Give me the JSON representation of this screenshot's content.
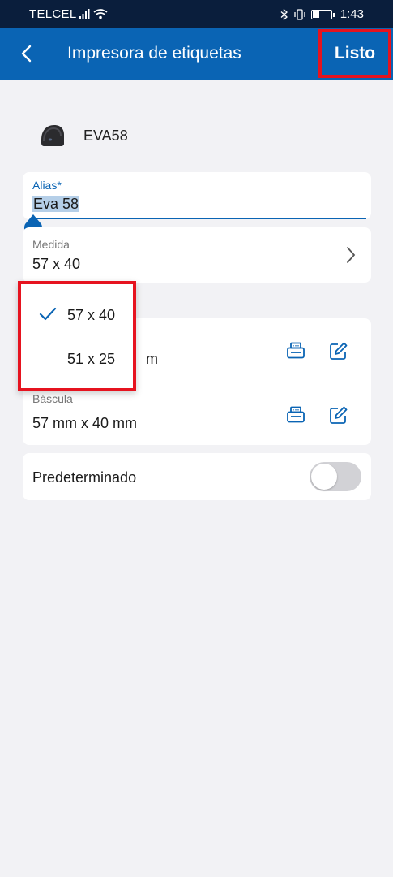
{
  "status_bar": {
    "carrier": "TELCEL",
    "time": "1:43"
  },
  "header": {
    "title": "Impresora de etiquetas",
    "done_label": "Listo"
  },
  "device": {
    "name": "EVA58",
    "icon": "label-printer-icon"
  },
  "alias": {
    "label": "Alias*",
    "value": "Eva 58"
  },
  "medida": {
    "label": "Medida",
    "value": "57 x 40"
  },
  "formats": {
    "rows": [
      {
        "label": "",
        "value": "m"
      },
      {
        "label": "Báscula",
        "value": "57 mm x 40 mm"
      }
    ]
  },
  "default_setting": {
    "label": "Predeterminado",
    "enabled": false
  },
  "size_dropdown": {
    "options": [
      {
        "label": "57 x 40",
        "selected": true
      },
      {
        "label": "51 x 25",
        "selected": false
      }
    ]
  },
  "colors": {
    "status_bar": "#0a1e3c",
    "app_bar": "#0a64b4",
    "accent": "#0a64b4",
    "highlight": "#e6131f",
    "background": "#f2f2f5"
  }
}
